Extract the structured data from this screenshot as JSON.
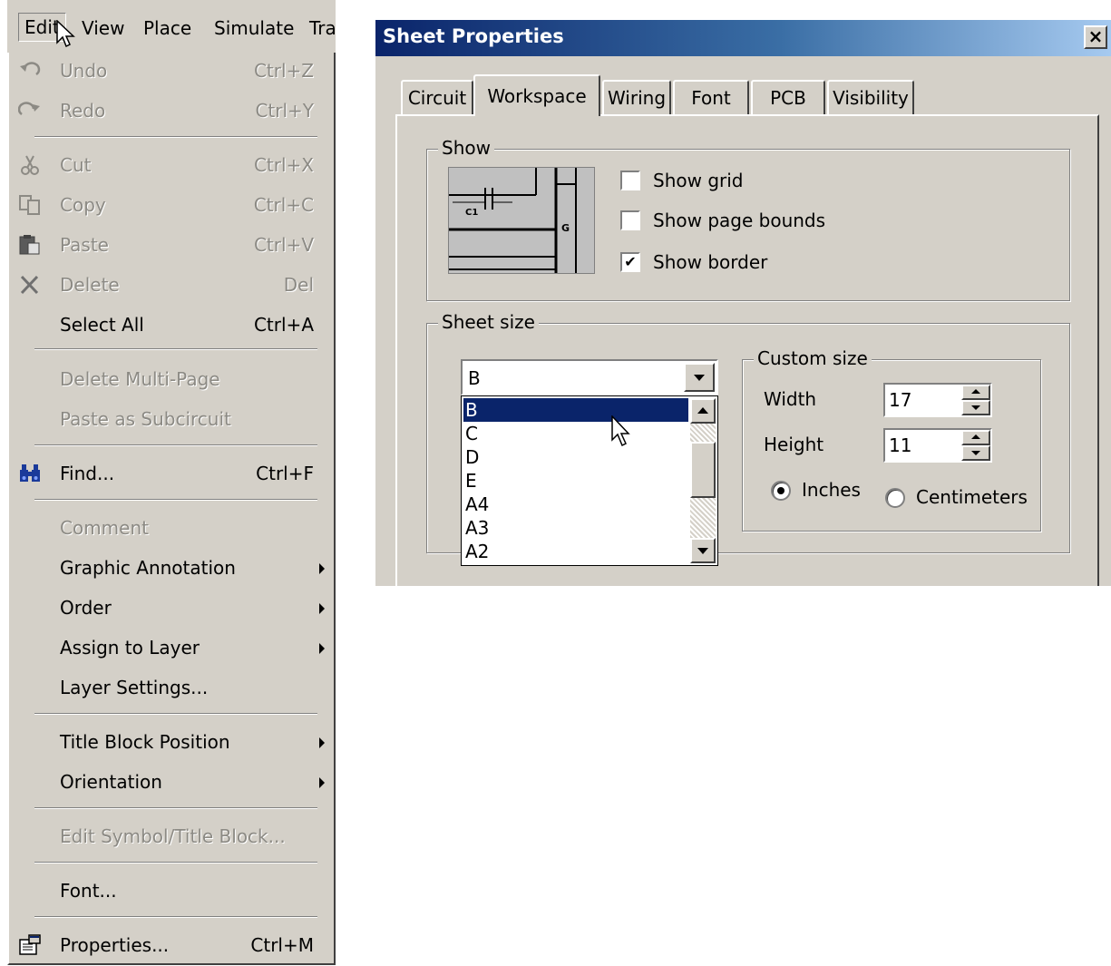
{
  "menubar": {
    "items": [
      "Edit",
      "View",
      "Place",
      "Simulate",
      "Tra"
    ]
  },
  "edit_menu": {
    "undo": {
      "label": "Undo",
      "shortcut": "Ctrl+Z"
    },
    "redo": {
      "label": "Redo",
      "shortcut": "Ctrl+Y"
    },
    "cut": {
      "label": "Cut",
      "shortcut": "Ctrl+X"
    },
    "copy": {
      "label": "Copy",
      "shortcut": "Ctrl+C"
    },
    "paste": {
      "label": "Paste",
      "shortcut": "Ctrl+V"
    },
    "delete": {
      "label": "Delete",
      "shortcut": "Del"
    },
    "select_all": {
      "label": "Select All",
      "shortcut": "Ctrl+A"
    },
    "delete_multi_page": {
      "label": "Delete Multi-Page"
    },
    "paste_as_subcircuit": {
      "label": "Paste as Subcircuit"
    },
    "find": {
      "label": "Find...",
      "shortcut": "Ctrl+F"
    },
    "comment": {
      "label": "Comment"
    },
    "graphic_annotation": {
      "label": "Graphic Annotation"
    },
    "order": {
      "label": "Order"
    },
    "assign_to_layer": {
      "label": "Assign to Layer"
    },
    "layer_settings": {
      "label": "Layer Settings..."
    },
    "title_block_position": {
      "label": "Title Block Position"
    },
    "orientation": {
      "label": "Orientation"
    },
    "edit_symbol": {
      "label": "Edit Symbol/Title Block..."
    },
    "font": {
      "label": "Font..."
    },
    "properties": {
      "label": "Properties...",
      "shortcut": "Ctrl+M"
    }
  },
  "dialog": {
    "title": "Sheet Properties",
    "close_glyph": "×",
    "tabs": [
      "Circuit",
      "Workspace",
      "Wiring",
      "Font",
      "PCB",
      "Visibility"
    ],
    "selected_tab": "Workspace",
    "show": {
      "title": "Show",
      "preview_labels": {
        "c1": "C1",
        "g": "G"
      },
      "show_grid": {
        "label": "Show grid",
        "checked": false
      },
      "show_page_bounds": {
        "label": "Show page bounds",
        "checked": false
      },
      "show_border": {
        "label": "Show border",
        "checked": true,
        "mark": "✔"
      }
    },
    "sheet_size": {
      "title": "Sheet size",
      "selected": "B",
      "options": [
        "B",
        "C",
        "D",
        "E",
        "A4",
        "A3",
        "A2"
      ],
      "highlighted": "B",
      "custom_size": {
        "title": "Custom size",
        "width_label": "Width",
        "width_value": "17",
        "height_label": "Height",
        "height_value": "11",
        "inches_label": "Inches",
        "centimeters_label": "Centimeters",
        "unit_selected": "Inches"
      }
    }
  }
}
